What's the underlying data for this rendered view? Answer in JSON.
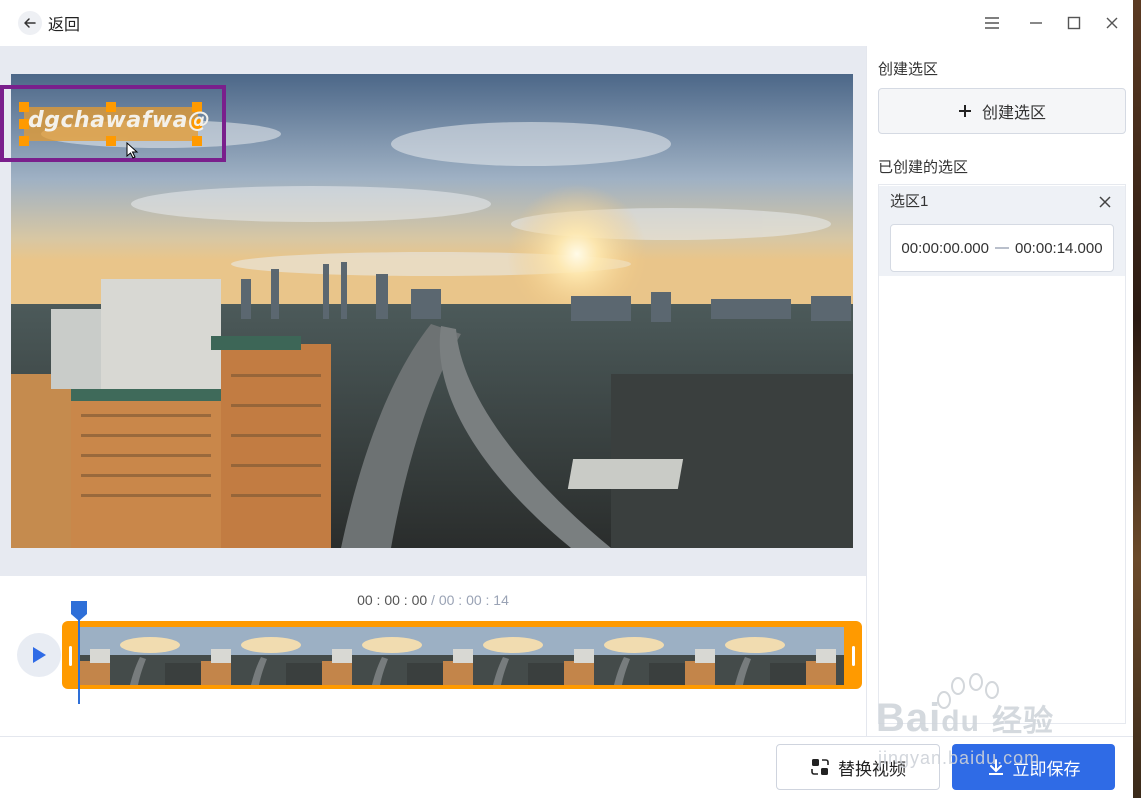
{
  "titlebar": {
    "back_label": "返回",
    "icons": [
      "back-arrow-icon",
      "menu-icon",
      "minimize-icon",
      "maximize-icon",
      "close-icon"
    ]
  },
  "video": {
    "watermark_selection_text": "dgchawafwa@",
    "scene": "city-skyline-sunset"
  },
  "timeline": {
    "current_time": "00 : 00 : 00",
    "separator": "/",
    "total_time": "00 : 00 : 14",
    "thumbnail_count": 7
  },
  "right_panel": {
    "create_section_label": "创建选区",
    "create_button_label": "创建选区",
    "created_section_label": "已创建的选区",
    "selections": [
      {
        "name": "选区1",
        "start": "00:00:00.000",
        "end": "00:00:14.000"
      }
    ]
  },
  "bottom": {
    "replace_button_label": "替换视频",
    "save_button_label": "立即保存"
  },
  "overlay_watermark": {
    "brand": "Bai",
    "brand_suffix": "du",
    "cn": "经验",
    "url": "jingyan.baidu.com"
  },
  "colors": {
    "accent_blue": "#2f6be6",
    "timeline_orange": "#ff9a00",
    "selection_box": "#7a1f8c",
    "handle_orange": "#ff9a00"
  }
}
